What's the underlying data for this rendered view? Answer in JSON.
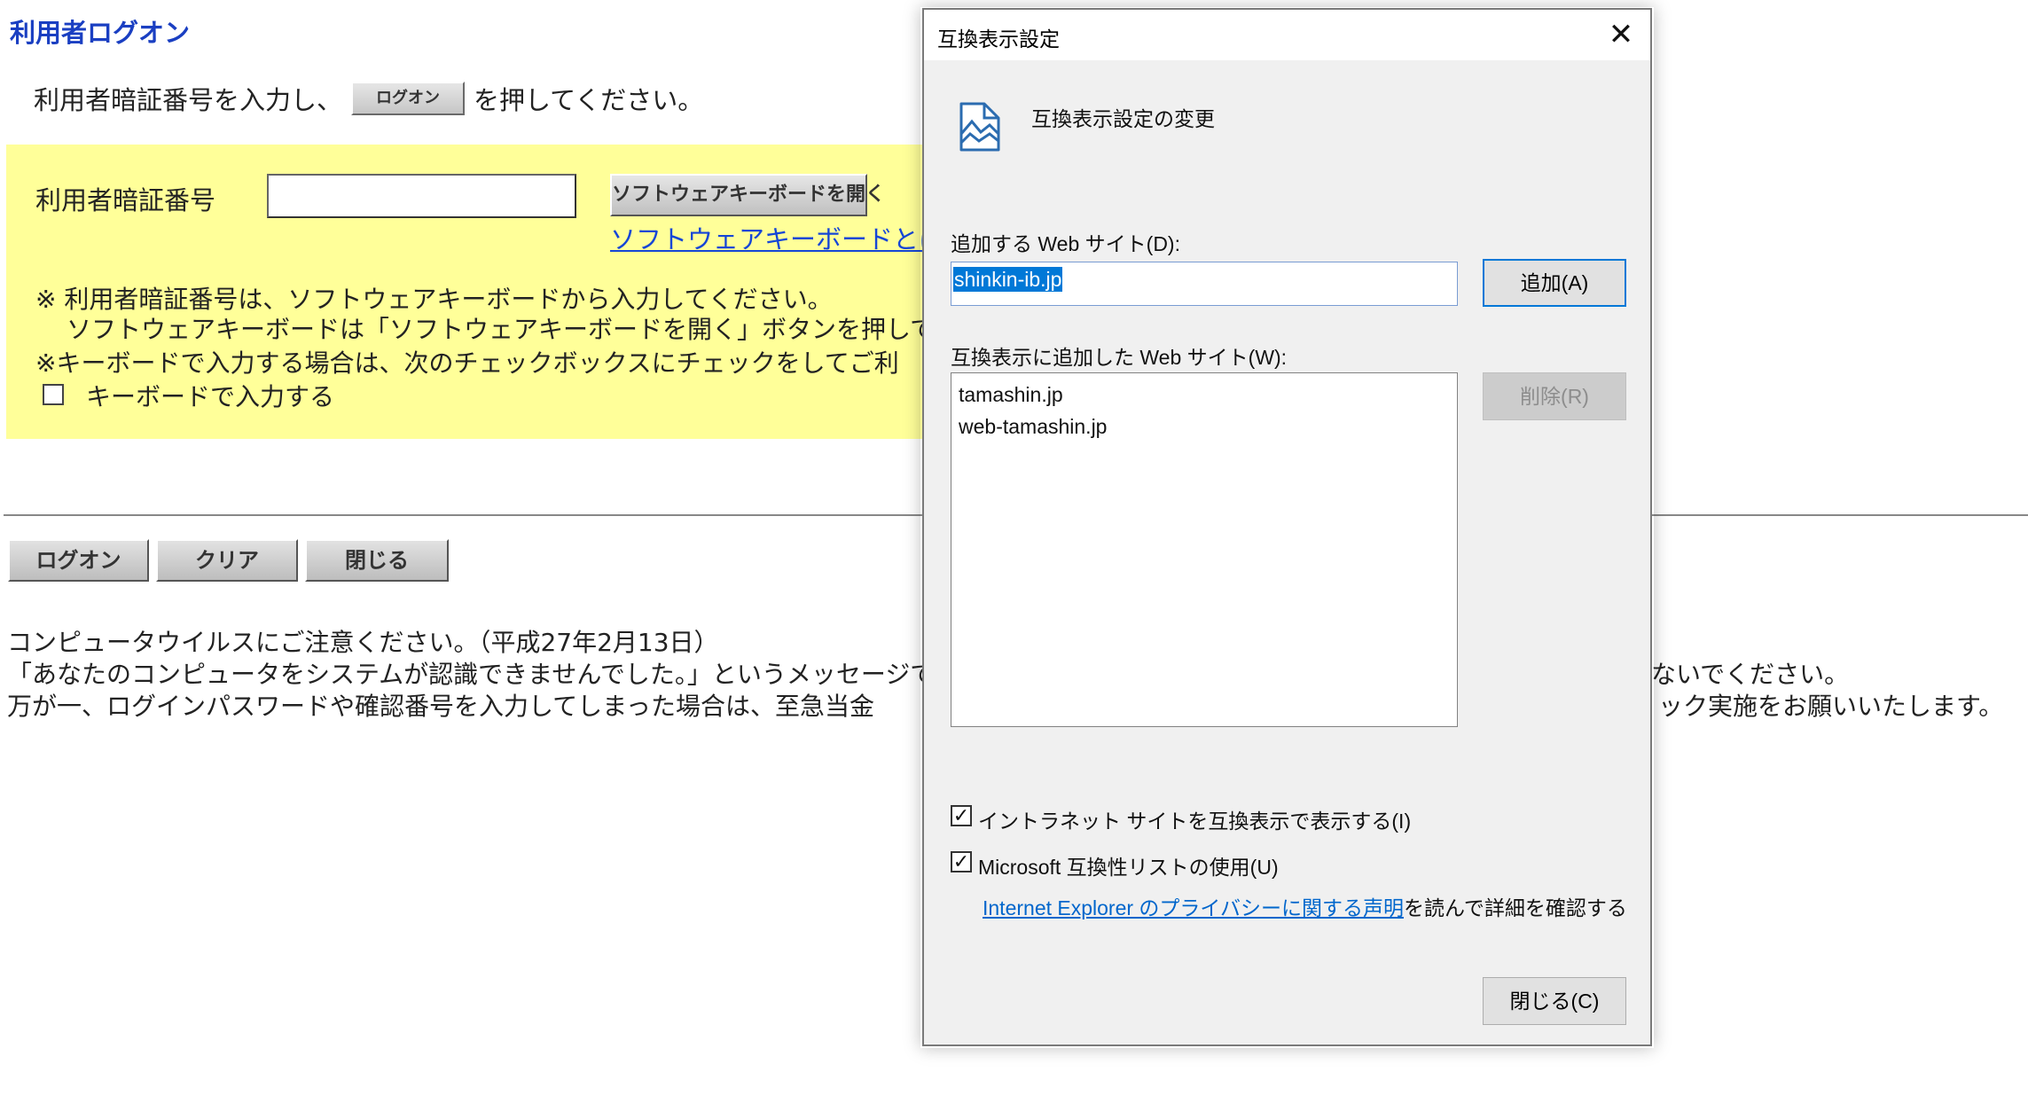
{
  "page": {
    "title": "利用者ログオン",
    "intro_before": "利用者暗証番号を入力し、",
    "intro_button": "ログオン",
    "intro_after": "を押してください。",
    "pin_label": "利用者暗証番号",
    "pin_value": "",
    "softkb_button": "ソフトウェアキーボードを開く",
    "softkb_link": "ソフトウェアキーボードとは",
    "note1": "※ 利用者暗証番号は、ソフトウェアキーボードから入力してください。",
    "note2": "ソフトウェアキーボードは「ソフトウェアキーボードを開く」ボタンを押してご",
    "note3": "※キーボードで入力する場合は、次のチェックボックスにチェックをしてご利",
    "keyboard_checkbox_label": "キーボードで入力する",
    "keyboard_checked": false,
    "buttons": {
      "logon": "ログオン",
      "clear": "クリア",
      "close": "閉じる"
    },
    "warning_line1": "コンピュータウイルスにご注意ください。（平成27年2月13日）",
    "warning_line2_left": "「あなたのコンピュータをシステムが認識できませんでした。」というメッセージで",
    "warning_line2_right": "ないでください。",
    "warning_line3_left": "万が一、ログインパスワードや確認番号を入力してしまった場合は、至急当金",
    "warning_line3_right": "ック実施をお願いいたします。"
  },
  "dialog": {
    "title": "互換表示設定",
    "heading": "互換表示設定の変更",
    "add_label": "追加する Web サイト(D):",
    "add_value": "shinkin-ib.jp",
    "add_button": "追加(A)",
    "list_label": "互換表示に追加した Web サイト(W):",
    "sites": [
      "tamashin.jp",
      "web-tamashin.jp"
    ],
    "remove_button": "削除(R)",
    "intranet_label": "イントラネット サイトを互換表示で表示する(I)",
    "intranet_checked": true,
    "mslist_label": "Microsoft 互換性リストの使用(U)",
    "mslist_checked": true,
    "privacy_link": "Internet Explorer のプライバシーに関する声明",
    "privacy_suffix": "を読んで詳細を確認する",
    "close_button": "閉じる(C)",
    "icons": [
      "close-icon",
      "compat-view-icon",
      "checkmark-icon"
    ]
  },
  "colors": {
    "title_blue": "#1a3fc2",
    "link_blue": "#1646d6",
    "highlight_yellow": "#ffff99",
    "selection_blue": "#0078d7",
    "dialog_bg": "#f0f0f0"
  }
}
